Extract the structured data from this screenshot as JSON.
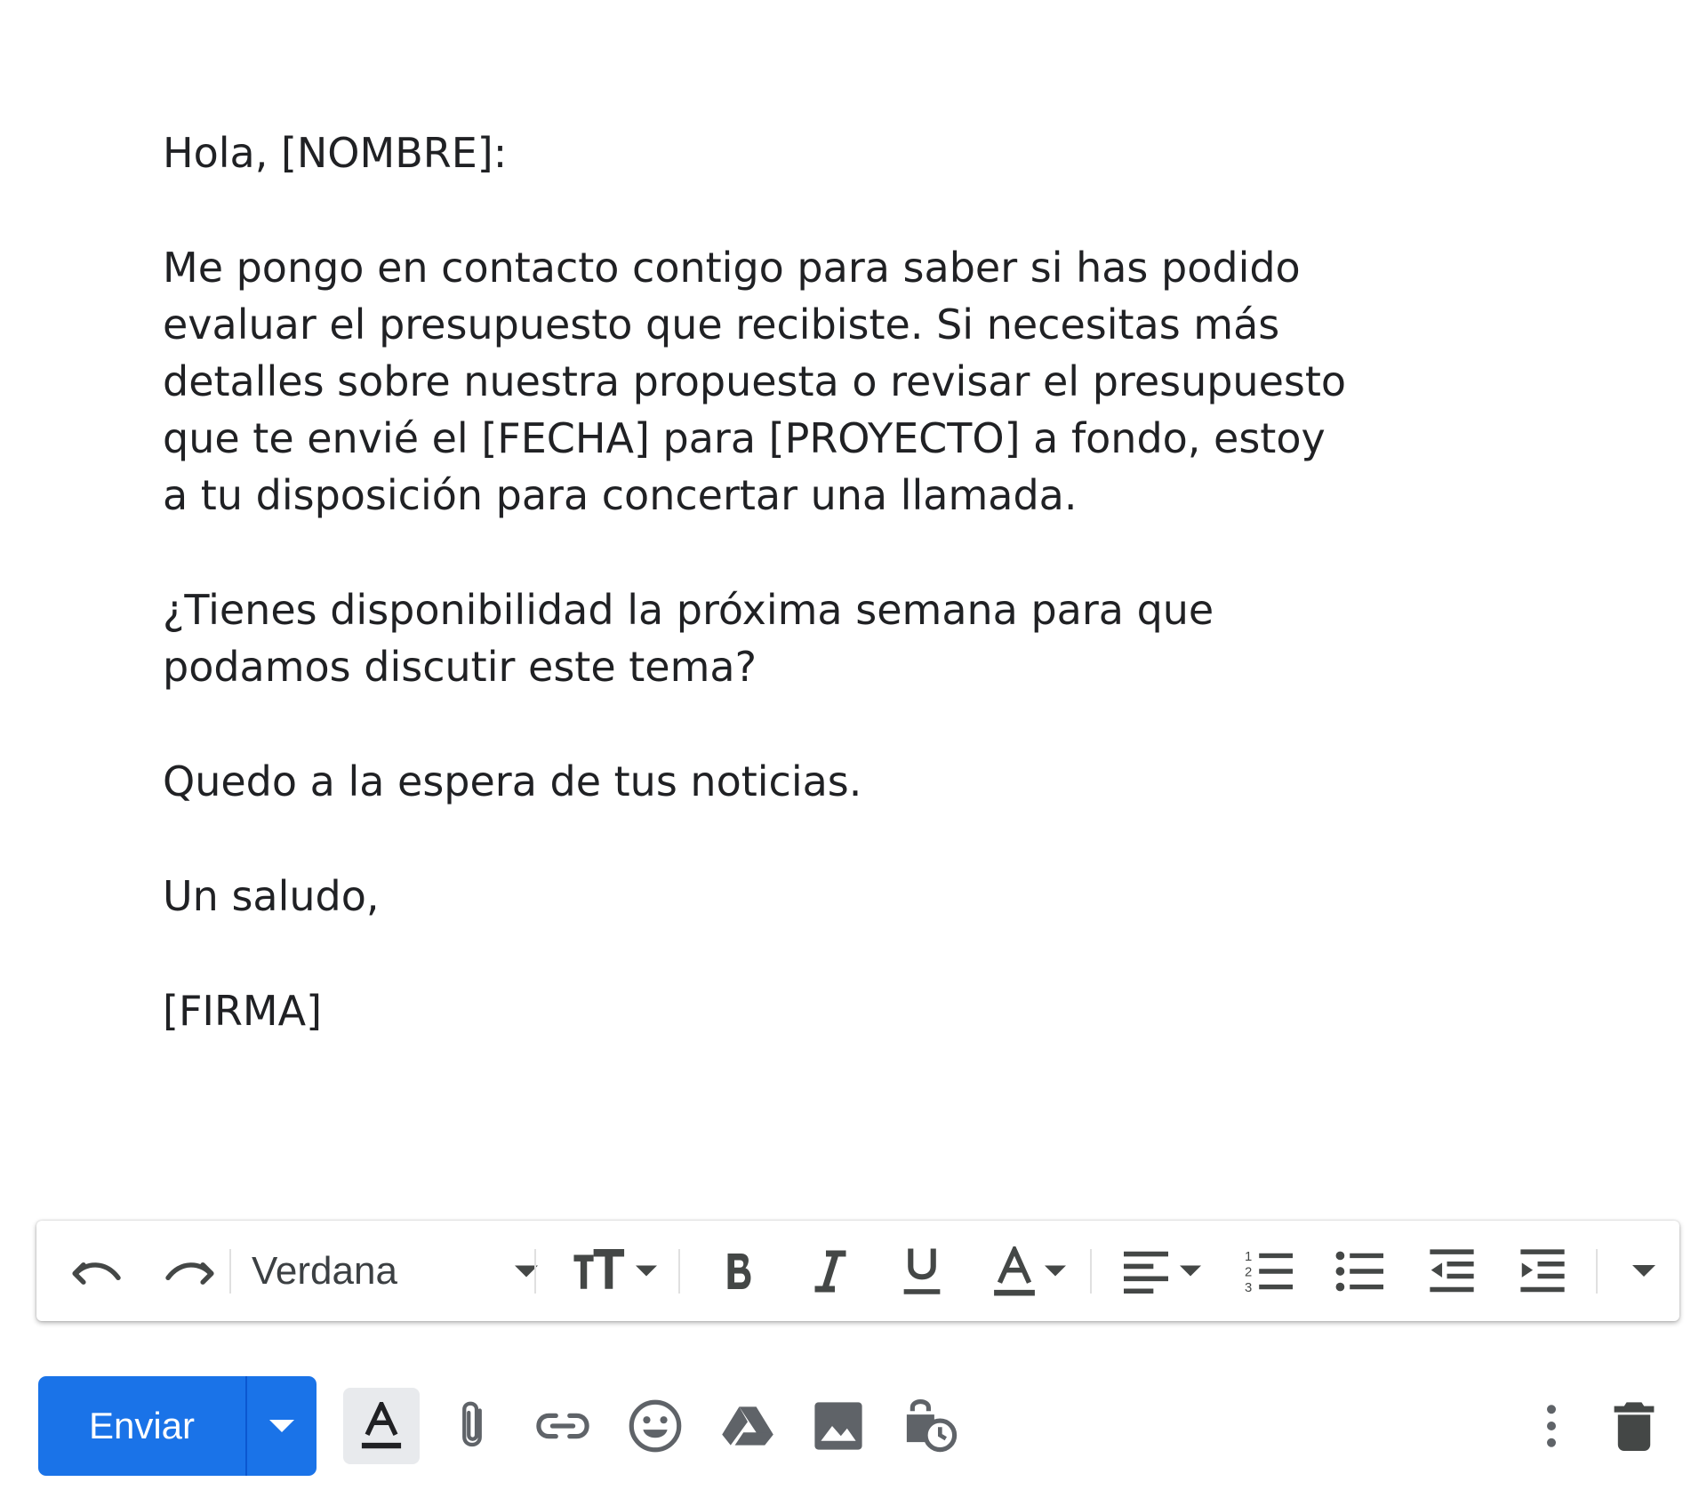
{
  "email": {
    "greeting": "Hola, [NOMBRE]:",
    "paragraph1": [
      "Me pongo en contacto contigo para saber si has podido",
      "evaluar el presupuesto que recibiste. Si necesitas más",
      "detalles sobre nuestra propuesta o revisar el presupuesto",
      "que te envié el [FECHA] para [PROYECTO] a fondo, estoy",
      "a tu disposición para concertar una llamada."
    ],
    "paragraph2": [
      "¿Tienes disponibilidad la próxima semana para que",
      "podamos discutir este tema?"
    ],
    "closing_line": "Quedo a la espera de tus noticias.",
    "sign_off": "Un saludo,",
    "signature": "[FIRMA]"
  },
  "toolbar": {
    "font_family": "Verdana",
    "icons": [
      "undo-icon",
      "redo-icon",
      "text-size-icon",
      "bold-icon",
      "italic-icon",
      "underline-icon",
      "text-color-icon",
      "align-icon",
      "numbered-list-icon",
      "bulleted-list-icon",
      "indent-less-icon",
      "indent-more-icon",
      "more-formatting-icon"
    ]
  },
  "actions": {
    "send_label": "Enviar",
    "icons": [
      "formatting-options-icon",
      "attach-icon",
      "link-icon",
      "emoji-icon",
      "drive-icon",
      "photo-icon",
      "confidential-mode-icon",
      "more-options-icon",
      "discard-icon"
    ]
  },
  "colors": {
    "send_button": "#1a73e8",
    "icon": "#444746",
    "text": "#202124"
  }
}
